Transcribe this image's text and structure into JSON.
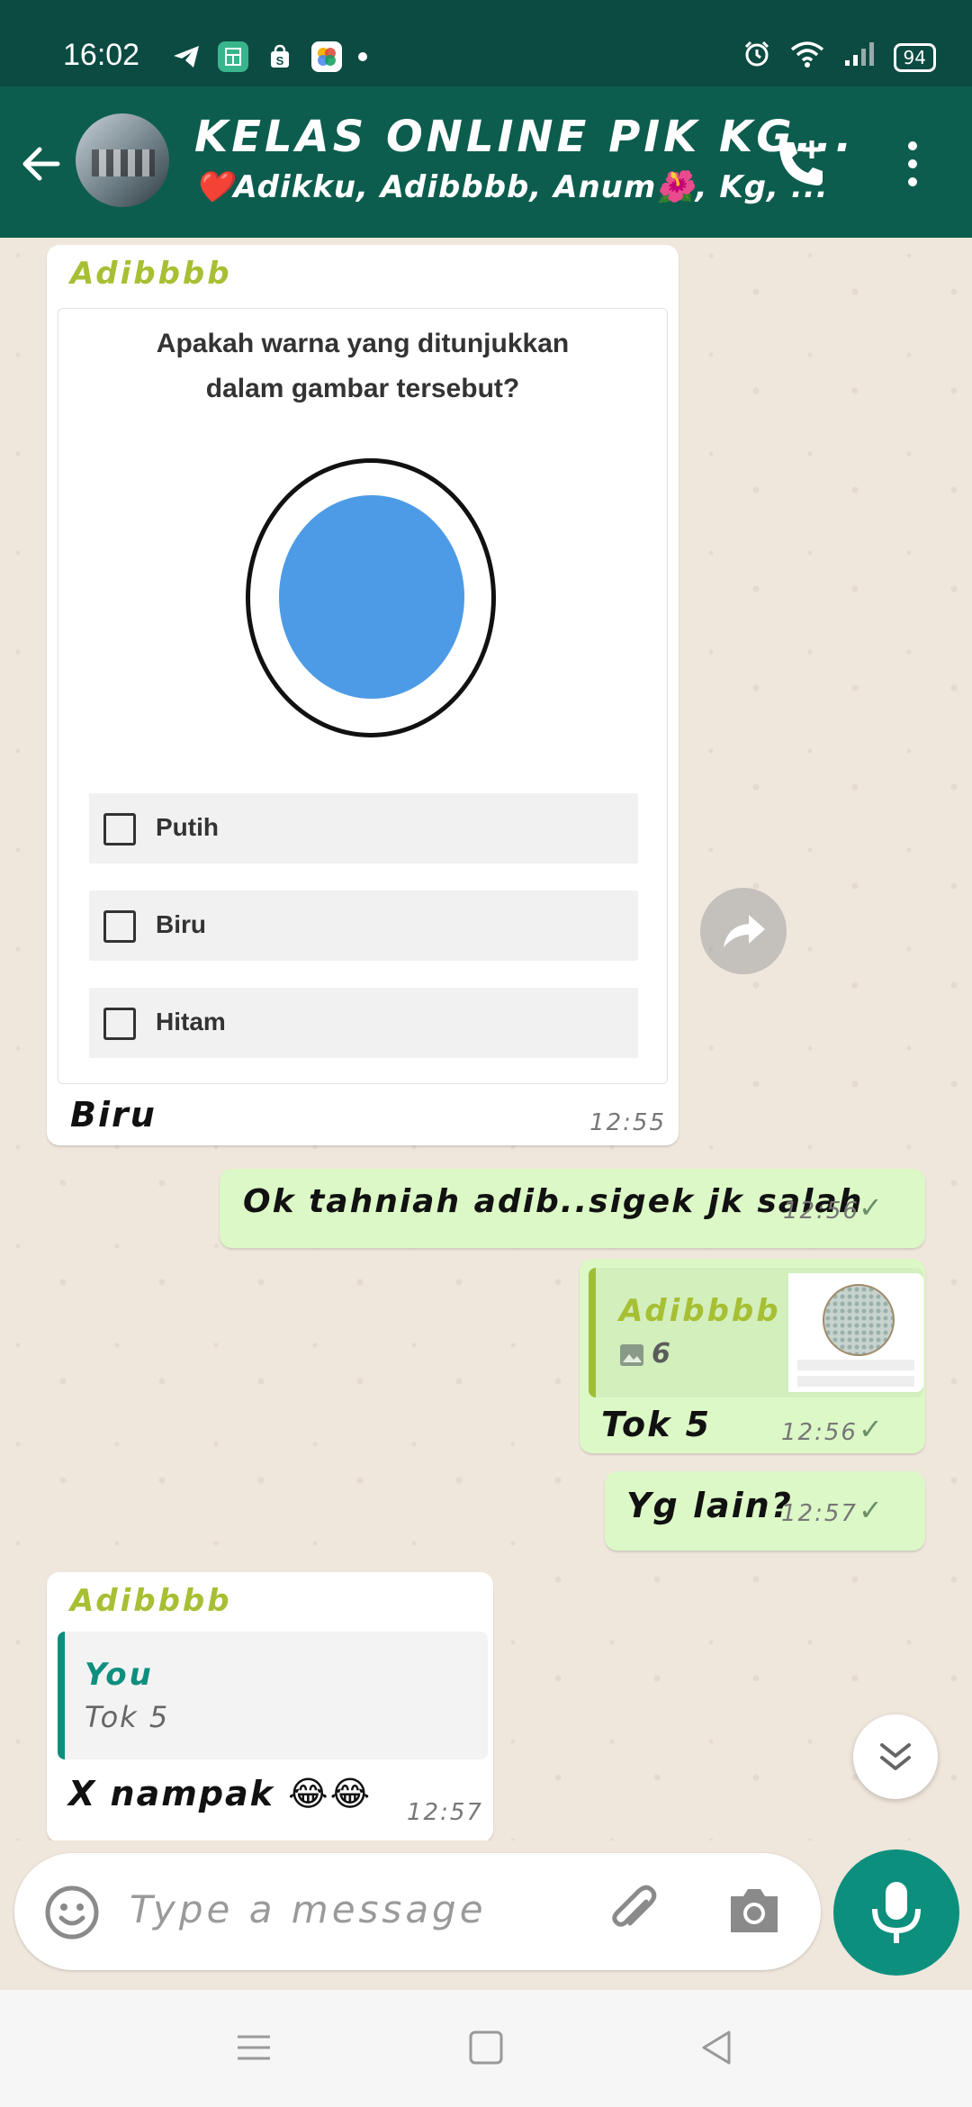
{
  "status_bar": {
    "time": "16:02",
    "battery": "94"
  },
  "header": {
    "group_name": "KELAS ONLINE PIK KG...",
    "members": "❤️Adikku, Adibbbb, Anum🌺, Kg, ..."
  },
  "messages": {
    "m1": {
      "sender": "Adibbbb",
      "quiz": {
        "question_line1": "Apakah warna yang ditunjukkan",
        "question_line2": "dalam gambar tersebut?",
        "options": [
          "Putih",
          "Biru",
          "Hitam"
        ]
      },
      "caption": "Biru",
      "time": "12:55"
    },
    "m2": {
      "text": "Ok tahniah adib..sigek jk salah",
      "time": "12:56"
    },
    "m3": {
      "quoted_sender": "Adibbbb",
      "quoted_count": "6",
      "text": "Tok 5",
      "time": "12:56"
    },
    "m4": {
      "text": "Yg lain?",
      "time": "12:57"
    },
    "m5": {
      "sender": "Adibbbb",
      "quoted_sender": "You",
      "quoted_text": "Tok 5",
      "text": "X nampak 😂😂",
      "time": "12:57"
    }
  },
  "composer": {
    "placeholder": "Type a message"
  },
  "colors": {
    "header": "#0c5d4e",
    "status_bar": "#0b4b42",
    "outgoing_bubble": "#dcf8c6",
    "incoming_bubble": "#ffffff",
    "accent": "#0d8f7e",
    "sender_name": "#a7bf33"
  }
}
